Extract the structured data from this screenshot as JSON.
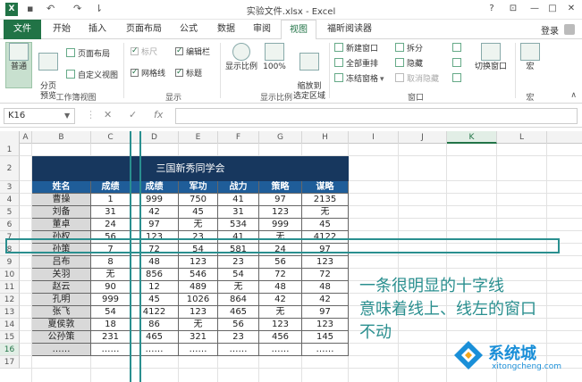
{
  "window": {
    "app_badge": "X",
    "title": "实验文件.xlsx - Excel",
    "help": "?",
    "restore": "⊡",
    "minimize": "—",
    "maximize": "□",
    "close": "✕",
    "login": "登录"
  },
  "quick_access": {
    "save": "▪",
    "undo": "↶",
    "redo": "↷",
    "customize": "⇂"
  },
  "tabs": [
    "文件",
    "开始",
    "插入",
    "页面布局",
    "公式",
    "数据",
    "审阅",
    "视图",
    "福昕阅读器"
  ],
  "ribbon": {
    "workbook_views": {
      "label": "工作簿视图",
      "normal": "普通",
      "page_break": "分页\n预览",
      "page_layout": "页面布局",
      "custom_views": "自定义视图"
    },
    "show": {
      "label": "显示",
      "ruler": "标尺",
      "formula_bar": "编辑栏",
      "gridlines": "网格线",
      "headings": "标题"
    },
    "zoom": {
      "label": "显示比例",
      "zoom": "显示比例",
      "hundred": "100%",
      "zoom_to_selection": "缩放到\n选定区域"
    },
    "window": {
      "label": "窗口",
      "new_window": "新建窗口",
      "arrange_all": "全部重排",
      "freeze_panes": "冻结窗格",
      "split": "拆分",
      "hide": "隐藏",
      "unhide": "取消隐藏",
      "switch_windows": "切换窗口"
    },
    "macros": {
      "label": "宏",
      "macros": "宏"
    },
    "collapse": "∧"
  },
  "formula_bar": {
    "name_box": "K16",
    "cancel": "✕",
    "enter": "✓",
    "fx": "fx"
  },
  "grid": {
    "columns": [
      "A",
      "B",
      "C",
      "D",
      "E",
      "F",
      "G",
      "H",
      "I",
      "J",
      "K",
      "L"
    ],
    "rows": [
      "1",
      "2",
      "3",
      "4",
      "5",
      "6",
      "7",
      "8",
      "9",
      "10",
      "11",
      "12",
      "13",
      "14",
      "15",
      "16",
      "17"
    ],
    "selected_column": "K",
    "selected_row": "16"
  },
  "table": {
    "title": "三国新秀同学会",
    "headers": [
      "姓名",
      "成绩",
      "成绩",
      "军功",
      "战力",
      "策略",
      "谋略"
    ],
    "rows": [
      [
        "曹操",
        "1",
        "999",
        "750",
        "41",
        "97",
        "2135"
      ],
      [
        "刘备",
        "31",
        "42",
        "45",
        "31",
        "123",
        "无"
      ],
      [
        "董卓",
        "24",
        "97",
        "无",
        "534",
        "999",
        "45"
      ],
      [
        "孙权",
        "56",
        "123",
        "23",
        "41",
        "无",
        "4122"
      ],
      [
        "孙策",
        "7",
        "72",
        "54",
        "581",
        "24",
        "97"
      ],
      [
        "吕布",
        "8",
        "48",
        "123",
        "23",
        "56",
        "123"
      ],
      [
        "关羽",
        "无",
        "856",
        "546",
        "54",
        "72",
        "72"
      ],
      [
        "赵云",
        "90",
        "12",
        "489",
        "无",
        "48",
        "48"
      ],
      [
        "孔明",
        "999",
        "45",
        "1026",
        "864",
        "42",
        "42"
      ],
      [
        "张飞",
        "54",
        "4122",
        "123",
        "465",
        "无",
        "97"
      ],
      [
        "夏侯敦",
        "18",
        "86",
        "无",
        "56",
        "123",
        "123"
      ],
      [
        "公孙策",
        "231",
        "465",
        "321",
        "23",
        "456",
        "145"
      ],
      [
        "……",
        "……",
        "……",
        "……",
        "……",
        "……",
        "……"
      ]
    ]
  },
  "annotation": {
    "line1": "一条很明显的十字线",
    "line2": "意味着线上、线左的窗口",
    "line3": "不动"
  },
  "watermark": {
    "brand": "系统城",
    "url": "xitongcheng.com"
  }
}
